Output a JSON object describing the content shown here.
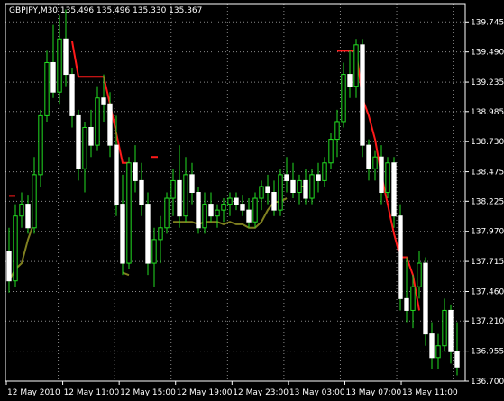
{
  "header": {
    "symbol_label": "GBPJPY,M30",
    "ohlc_label": "135.496 135.496 135.330 135.367"
  },
  "colors": {
    "background": "#000000",
    "grid": "#8a8a8a",
    "axis": "#ffffff",
    "bull_candle_body": "#000000",
    "bull_candle_border": "#22dd22",
    "bear_candle_body": "#ffffff",
    "bear_candle_border": "#ffffff",
    "wick": "#22dd22",
    "downtrend_line": "#ff1a1a",
    "uptrend_line": "#808020",
    "text": "#ffffff"
  },
  "chart_data": {
    "type": "candlestick",
    "symbol": "GBPJPY",
    "timeframe": "M30",
    "price_ticks": [
      "139.745",
      "139.490",
      "139.235",
      "138.985",
      "138.730",
      "138.475",
      "138.225",
      "137.970",
      "137.715",
      "137.460",
      "137.210",
      "136.955",
      "136.700"
    ],
    "time_ticks": [
      "12 May 2010",
      "12 May 11:00",
      "12 May 15:00",
      "12 May 19:00",
      "12 May 23:00",
      "13 May 03:00",
      "13 May 07:00",
      "13 May 11:00"
    ],
    "ylim": [
      136.7,
      139.9
    ],
    "grid": true,
    "candles": [
      [
        137.8,
        138.0,
        137.45,
        137.55
      ],
      [
        137.55,
        138.2,
        137.5,
        138.1
      ],
      [
        138.1,
        138.3,
        138.0,
        138.2
      ],
      [
        138.2,
        138.28,
        137.95,
        138.0
      ],
      [
        138.0,
        138.6,
        137.95,
        138.45
      ],
      [
        138.45,
        139.0,
        138.35,
        138.95
      ],
      [
        138.95,
        139.5,
        138.9,
        139.4
      ],
      [
        139.4,
        139.72,
        139.1,
        139.15
      ],
      [
        139.15,
        139.8,
        139.05,
        139.6
      ],
      [
        139.6,
        139.85,
        139.2,
        139.3
      ],
      [
        139.3,
        139.35,
        138.85,
        138.95
      ],
      [
        138.95,
        139.0,
        138.4,
        138.5
      ],
      [
        138.5,
        138.9,
        138.3,
        138.85
      ],
      [
        138.85,
        139.0,
        138.6,
        138.7
      ],
      [
        138.7,
        139.2,
        138.65,
        139.1
      ],
      [
        139.1,
        139.3,
        138.9,
        139.05
      ],
      [
        139.05,
        139.15,
        138.6,
        138.7
      ],
      [
        138.7,
        138.95,
        138.1,
        138.2
      ],
      [
        138.2,
        138.45,
        137.6,
        137.7
      ],
      [
        137.7,
        138.6,
        137.65,
        138.55
      ],
      [
        138.55,
        138.7,
        138.3,
        138.4
      ],
      [
        138.4,
        138.55,
        138.1,
        138.2
      ],
      [
        138.2,
        138.3,
        137.6,
        137.7
      ],
      [
        137.7,
        138.0,
        137.5,
        137.9
      ],
      [
        137.9,
        138.1,
        137.7,
        138.0
      ],
      [
        138.0,
        138.3,
        137.95,
        138.25
      ],
      [
        138.25,
        138.5,
        138.1,
        138.4
      ],
      [
        138.4,
        138.7,
        138.0,
        138.1
      ],
      [
        138.1,
        138.6,
        138.05,
        138.45
      ],
      [
        138.45,
        138.55,
        138.2,
        138.3
      ],
      [
        138.3,
        138.35,
        137.95,
        138.0
      ],
      [
        138.0,
        138.3,
        137.95,
        138.2
      ],
      [
        138.2,
        138.3,
        138.05,
        138.1
      ],
      [
        138.1,
        138.2,
        138.0,
        138.15
      ],
      [
        138.15,
        138.25,
        138.05,
        138.2
      ],
      [
        138.2,
        138.3,
        138.1,
        138.25
      ],
      [
        138.25,
        138.3,
        138.15,
        138.2
      ],
      [
        138.2,
        138.28,
        138.1,
        138.15
      ],
      [
        138.15,
        138.25,
        138.0,
        138.05
      ],
      [
        138.05,
        138.3,
        138.0,
        138.25
      ],
      [
        138.25,
        138.4,
        138.15,
        138.35
      ],
      [
        138.35,
        138.45,
        138.2,
        138.3
      ],
      [
        138.3,
        138.4,
        138.1,
        138.15
      ],
      [
        138.15,
        138.5,
        138.1,
        138.45
      ],
      [
        138.45,
        138.6,
        138.3,
        138.4
      ],
      [
        138.4,
        138.55,
        138.25,
        138.3
      ],
      [
        138.3,
        138.45,
        138.2,
        138.4
      ],
      [
        138.4,
        138.5,
        138.2,
        138.25
      ],
      [
        138.25,
        138.5,
        138.2,
        138.45
      ],
      [
        138.45,
        138.55,
        138.3,
        138.4
      ],
      [
        138.4,
        138.6,
        138.35,
        138.55
      ],
      [
        138.55,
        138.8,
        138.5,
        138.75
      ],
      [
        138.75,
        139.0,
        138.6,
        138.9
      ],
      [
        138.9,
        139.4,
        138.85,
        139.3
      ],
      [
        139.3,
        139.5,
        139.1,
        139.2
      ],
      [
        139.2,
        139.6,
        139.1,
        139.55
      ],
      [
        139.55,
        139.6,
        138.6,
        138.7
      ],
      [
        138.7,
        138.75,
        138.4,
        138.5
      ],
      [
        138.5,
        138.65,
        138.4,
        138.6
      ],
      [
        138.6,
        138.7,
        138.2,
        138.3
      ],
      [
        138.3,
        138.6,
        138.25,
        138.55
      ],
      [
        138.55,
        138.6,
        138.0,
        138.1
      ],
      [
        138.1,
        138.2,
        137.3,
        137.4
      ],
      [
        137.4,
        137.75,
        137.2,
        137.3
      ],
      [
        137.3,
        137.6,
        137.15,
        137.5
      ],
      [
        137.5,
        137.8,
        137.4,
        137.7
      ],
      [
        137.7,
        137.75,
        137.0,
        137.1
      ],
      [
        137.1,
        137.2,
        136.8,
        136.9
      ],
      [
        136.9,
        137.1,
        136.8,
        137.0
      ],
      [
        137.0,
        137.4,
        136.95,
        137.3
      ],
      [
        137.3,
        137.35,
        136.85,
        136.95
      ],
      [
        136.95,
        137.2,
        136.75,
        136.82
      ]
    ],
    "downtrend_segments": [
      [
        [
          0,
          138.27
        ],
        [
          1,
          138.27
        ]
      ],
      [
        [
          10,
          139.58
        ],
        [
          11,
          139.28
        ],
        [
          12,
          139.28
        ],
        [
          13,
          139.28
        ],
        [
          14,
          139.28
        ],
        [
          15,
          139.28
        ],
        [
          16,
          139.05
        ],
        [
          17,
          138.8
        ],
        [
          18,
          138.55
        ],
        [
          19,
          138.55
        ]
      ],
      [
        [
          23,
          138.6
        ]
      ],
      [
        [
          52,
          139.5
        ],
        [
          53,
          139.5
        ],
        [
          54,
          139.5
        ],
        [
          55,
          139.5
        ],
        [
          56,
          139.1
        ],
        [
          57,
          138.95
        ],
        [
          58,
          138.75
        ],
        [
          59,
          138.45
        ],
        [
          60,
          138.2
        ],
        [
          61,
          137.95
        ],
        [
          62,
          137.75
        ],
        [
          63,
          137.75
        ],
        [
          64,
          137.6
        ],
        [
          65,
          137.3
        ]
      ]
    ],
    "uptrend_segments": [
      [
        [
          0,
          137.55
        ],
        [
          1,
          137.65
        ],
        [
          2,
          137.7
        ],
        [
          3,
          137.9
        ],
        [
          4,
          138.05
        ]
      ],
      [
        [
          18,
          137.62
        ],
        [
          19,
          137.6
        ]
      ],
      [
        [
          26,
          138.05
        ],
        [
          27,
          138.05
        ],
        [
          28,
          138.05
        ],
        [
          29,
          138.05
        ],
        [
          30,
          138.03
        ],
        [
          31,
          138.05
        ],
        [
          32,
          138.05
        ],
        [
          33,
          138.05
        ],
        [
          34,
          138.03
        ],
        [
          35,
          138.05
        ],
        [
          36,
          138.03
        ],
        [
          37,
          138.03
        ],
        [
          38,
          138.0
        ],
        [
          39,
          138.0
        ],
        [
          40,
          138.05
        ],
        [
          41,
          138.15
        ],
        [
          42,
          138.22
        ],
        [
          43,
          138.22
        ],
        [
          44,
          138.25
        ]
      ],
      [
        [
          46,
          138.35
        ],
        [
          47,
          138.35
        ]
      ]
    ]
  }
}
